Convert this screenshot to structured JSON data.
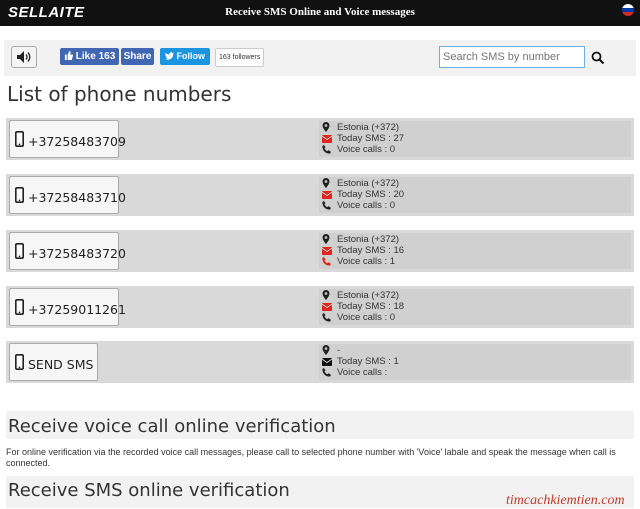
{
  "header": {
    "logo": "SELLAITE",
    "title": "Receive SMS Online and Voice messages",
    "flag_colors": [
      "#ffffff",
      "#0039a6",
      "#d52b1e"
    ]
  },
  "toolbar": {
    "speaker_icon": "speaker-icon",
    "like_label": "Like 163",
    "share_label": "Share",
    "follow_label": "Follow",
    "followers_label": "163 followers",
    "search_placeholder": "Search SMS by number",
    "search_icon": "search-icon"
  },
  "main": {
    "list_title": "List of phone numbers",
    "numbers": [
      {
        "number": "+37258483709",
        "country": "Estonia (+372)",
        "today_sms": "Today SMS : 27",
        "voice_calls": "Voice calls : 0",
        "voice_active": false
      },
      {
        "number": "+37258483710",
        "country": "Estonia (+372)",
        "today_sms": "Today SMS : 20",
        "voice_calls": "Voice calls : 0",
        "voice_active": false
      },
      {
        "number": "+37258483720",
        "country": "Estonia (+372)",
        "today_sms": "Today SMS : 16",
        "voice_calls": "Voice calls : 1",
        "voice_active": true
      },
      {
        "number": "+37259011261",
        "country": "Estonia (+372)",
        "today_sms": "Today SMS : 18",
        "voice_calls": "Voice calls : 0",
        "voice_active": false
      }
    ],
    "send_sms": {
      "label": "SEND SMS",
      "country": "-",
      "today_sms": "Today SMS : 1",
      "voice_calls": "Voice calls :"
    },
    "voice_section_title": "Receive voice call online verification",
    "voice_section_text": "For online verification via the recorded voice call messages, please call to selected phone number with 'Voice' labale and speak the message when call is connected.",
    "sms_section_title": "Receive SMS online verification"
  },
  "watermark": "timcachkiemtien.com",
  "colors": {
    "accent_red": "#e0241b",
    "facebook": "#4267b2",
    "twitter": "#1b95e0"
  }
}
